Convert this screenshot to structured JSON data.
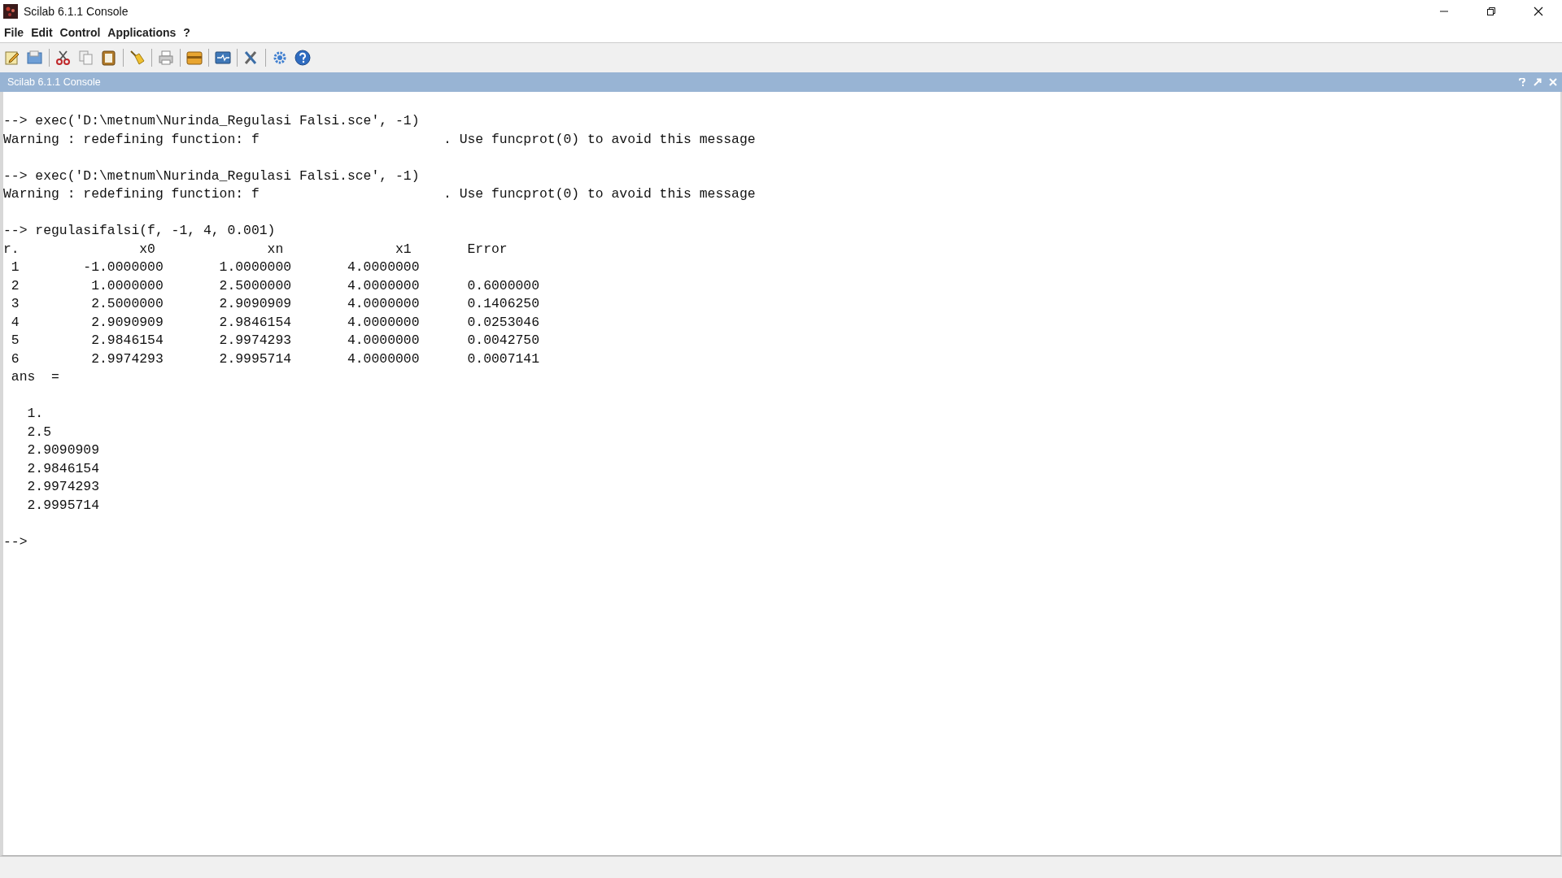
{
  "window": {
    "title": "Scilab 6.1.1 Console"
  },
  "menu": [
    "File",
    "Edit",
    "Control",
    "Applications",
    "?"
  ],
  "console_panel": {
    "title": "Scilab 6.1.1 Console"
  },
  "console_blocks": [
    {
      "lines": [
        "--> exec('D:\\metnum\\Nurinda_Regulasi Falsi.sce', -1)",
        "Warning : redefining function: f                       . Use funcprot(0) to avoid this message"
      ]
    },
    {
      "lines": [
        "--> exec('D:\\metnum\\Nurinda_Regulasi Falsi.sce', -1)",
        "Warning : redefining function: f                       . Use funcprot(0) to avoid this message"
      ]
    },
    {
      "lines": [
        "--> regulasifalsi(f, -1, 4, 0.001)",
        "r.               x0              xn              x1       Error",
        " 1        -1.0000000       1.0000000       4.0000000",
        " 2         1.0000000       2.5000000       4.0000000      0.6000000",
        " 3         2.5000000       2.9090909       4.0000000      0.1406250",
        " 4         2.9090909       2.9846154       4.0000000      0.0253046",
        " 5         2.9846154       2.9974293       4.0000000      0.0042750",
        " 6         2.9974293       2.9995714       4.0000000      0.0007141",
        " ans  ="
      ]
    },
    {
      "lines": [
        "   1.",
        "   2.5",
        "   2.9090909",
        "   2.9846154",
        "   2.9974293",
        "   2.9995714"
      ]
    },
    {
      "lines": [
        "-->"
      ]
    }
  ]
}
